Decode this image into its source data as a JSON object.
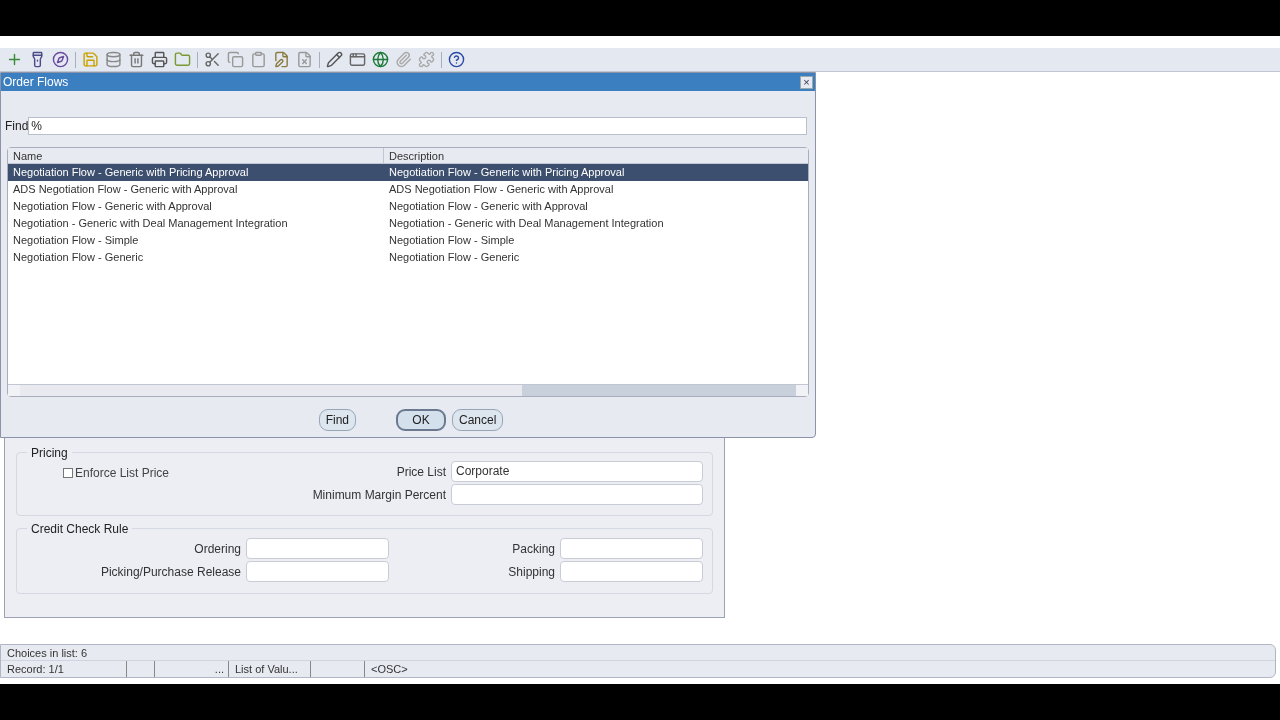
{
  "dialog": {
    "title": "Order Flows",
    "close": "×",
    "find_label": "Find",
    "find_value": "%",
    "columns": [
      "Name",
      "Description"
    ],
    "rows": [
      {
        "name": "Negotiation Flow - Generic with Pricing Approval",
        "description": "Negotiation Flow - Generic with Pricing Approval",
        "selected": true
      },
      {
        "name": "ADS Negotiation Flow - Generic with Approval",
        "description": "ADS Negotiation Flow - Generic with Approval",
        "selected": false
      },
      {
        "name": "Negotiation Flow - Generic with Approval",
        "description": "Negotiation Flow - Generic with Approval",
        "selected": false
      },
      {
        "name": "Negotiation - Generic with Deal Management Integration",
        "description": "Negotiation - Generic with Deal Management Integration",
        "selected": false
      },
      {
        "name": "Negotiation Flow - Simple",
        "description": "Negotiation Flow - Simple",
        "selected": false
      },
      {
        "name": "Negotiation Flow - Generic",
        "description": "Negotiation Flow - Generic",
        "selected": false
      }
    ],
    "buttons": [
      {
        "label": "Find",
        "default": false
      },
      {
        "label": "OK",
        "default": true
      },
      {
        "label": "Cancel",
        "default": false
      }
    ]
  },
  "pricing": {
    "title": "Pricing",
    "enforce_list_price": {
      "label": "Enforce List Price",
      "checked": false
    },
    "fields": [
      {
        "label": "Price List",
        "value": "Corporate"
      },
      {
        "label": "Minimum Margin Percent"
      }
    ]
  },
  "credit_check_rule": {
    "title": "Credit Check Rule",
    "fields": [
      {
        "label": "Ordering"
      },
      {
        "label": "Packing"
      },
      {
        "label": "Picking/Purchase Release"
      },
      {
        "label": "Shipping"
      }
    ]
  },
  "status_bar": {
    "message": "Choices in list: 6",
    "cells": [
      "Record: 1/1",
      "",
      "...",
      "List of Valu...",
      "",
      "<OSC>"
    ]
  }
}
